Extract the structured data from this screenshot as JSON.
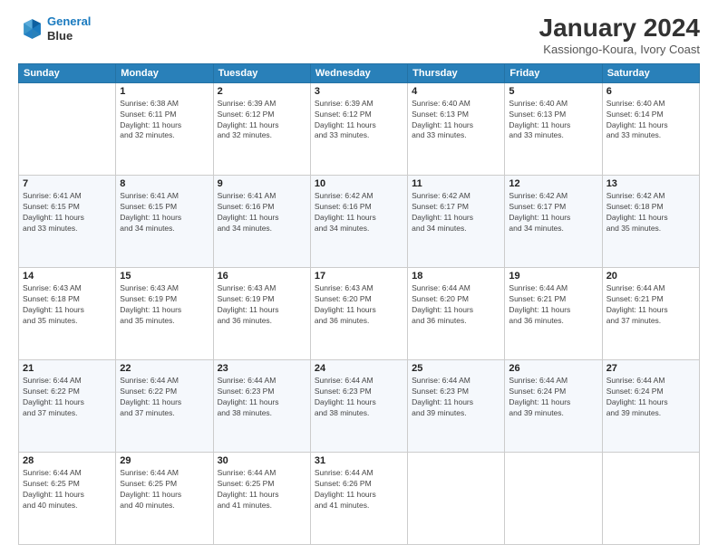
{
  "logo": {
    "line1": "General",
    "line2": "Blue"
  },
  "title": "January 2024",
  "subtitle": "Kassiongo-Koura, Ivory Coast",
  "weekdays": [
    "Sunday",
    "Monday",
    "Tuesday",
    "Wednesday",
    "Thursday",
    "Friday",
    "Saturday"
  ],
  "weeks": [
    [
      {
        "day": "",
        "info": ""
      },
      {
        "day": "1",
        "info": "Sunrise: 6:38 AM\nSunset: 6:11 PM\nDaylight: 11 hours\nand 32 minutes."
      },
      {
        "day": "2",
        "info": "Sunrise: 6:39 AM\nSunset: 6:12 PM\nDaylight: 11 hours\nand 32 minutes."
      },
      {
        "day": "3",
        "info": "Sunrise: 6:39 AM\nSunset: 6:12 PM\nDaylight: 11 hours\nand 33 minutes."
      },
      {
        "day": "4",
        "info": "Sunrise: 6:40 AM\nSunset: 6:13 PM\nDaylight: 11 hours\nand 33 minutes."
      },
      {
        "day": "5",
        "info": "Sunrise: 6:40 AM\nSunset: 6:13 PM\nDaylight: 11 hours\nand 33 minutes."
      },
      {
        "day": "6",
        "info": "Sunrise: 6:40 AM\nSunset: 6:14 PM\nDaylight: 11 hours\nand 33 minutes."
      }
    ],
    [
      {
        "day": "7",
        "info": "Sunrise: 6:41 AM\nSunset: 6:15 PM\nDaylight: 11 hours\nand 33 minutes."
      },
      {
        "day": "8",
        "info": "Sunrise: 6:41 AM\nSunset: 6:15 PM\nDaylight: 11 hours\nand 34 minutes."
      },
      {
        "day": "9",
        "info": "Sunrise: 6:41 AM\nSunset: 6:16 PM\nDaylight: 11 hours\nand 34 minutes."
      },
      {
        "day": "10",
        "info": "Sunrise: 6:42 AM\nSunset: 6:16 PM\nDaylight: 11 hours\nand 34 minutes."
      },
      {
        "day": "11",
        "info": "Sunrise: 6:42 AM\nSunset: 6:17 PM\nDaylight: 11 hours\nand 34 minutes."
      },
      {
        "day": "12",
        "info": "Sunrise: 6:42 AM\nSunset: 6:17 PM\nDaylight: 11 hours\nand 34 minutes."
      },
      {
        "day": "13",
        "info": "Sunrise: 6:42 AM\nSunset: 6:18 PM\nDaylight: 11 hours\nand 35 minutes."
      }
    ],
    [
      {
        "day": "14",
        "info": "Sunrise: 6:43 AM\nSunset: 6:18 PM\nDaylight: 11 hours\nand 35 minutes."
      },
      {
        "day": "15",
        "info": "Sunrise: 6:43 AM\nSunset: 6:19 PM\nDaylight: 11 hours\nand 35 minutes."
      },
      {
        "day": "16",
        "info": "Sunrise: 6:43 AM\nSunset: 6:19 PM\nDaylight: 11 hours\nand 36 minutes."
      },
      {
        "day": "17",
        "info": "Sunrise: 6:43 AM\nSunset: 6:20 PM\nDaylight: 11 hours\nand 36 minutes."
      },
      {
        "day": "18",
        "info": "Sunrise: 6:44 AM\nSunset: 6:20 PM\nDaylight: 11 hours\nand 36 minutes."
      },
      {
        "day": "19",
        "info": "Sunrise: 6:44 AM\nSunset: 6:21 PM\nDaylight: 11 hours\nand 36 minutes."
      },
      {
        "day": "20",
        "info": "Sunrise: 6:44 AM\nSunset: 6:21 PM\nDaylight: 11 hours\nand 37 minutes."
      }
    ],
    [
      {
        "day": "21",
        "info": "Sunrise: 6:44 AM\nSunset: 6:22 PM\nDaylight: 11 hours\nand 37 minutes."
      },
      {
        "day": "22",
        "info": "Sunrise: 6:44 AM\nSunset: 6:22 PM\nDaylight: 11 hours\nand 37 minutes."
      },
      {
        "day": "23",
        "info": "Sunrise: 6:44 AM\nSunset: 6:23 PM\nDaylight: 11 hours\nand 38 minutes."
      },
      {
        "day": "24",
        "info": "Sunrise: 6:44 AM\nSunset: 6:23 PM\nDaylight: 11 hours\nand 38 minutes."
      },
      {
        "day": "25",
        "info": "Sunrise: 6:44 AM\nSunset: 6:23 PM\nDaylight: 11 hours\nand 39 minutes."
      },
      {
        "day": "26",
        "info": "Sunrise: 6:44 AM\nSunset: 6:24 PM\nDaylight: 11 hours\nand 39 minutes."
      },
      {
        "day": "27",
        "info": "Sunrise: 6:44 AM\nSunset: 6:24 PM\nDaylight: 11 hours\nand 39 minutes."
      }
    ],
    [
      {
        "day": "28",
        "info": "Sunrise: 6:44 AM\nSunset: 6:25 PM\nDaylight: 11 hours\nand 40 minutes."
      },
      {
        "day": "29",
        "info": "Sunrise: 6:44 AM\nSunset: 6:25 PM\nDaylight: 11 hours\nand 40 minutes."
      },
      {
        "day": "30",
        "info": "Sunrise: 6:44 AM\nSunset: 6:25 PM\nDaylight: 11 hours\nand 41 minutes."
      },
      {
        "day": "31",
        "info": "Sunrise: 6:44 AM\nSunset: 6:26 PM\nDaylight: 11 hours\nand 41 minutes."
      },
      {
        "day": "",
        "info": ""
      },
      {
        "day": "",
        "info": ""
      },
      {
        "day": "",
        "info": ""
      }
    ]
  ]
}
